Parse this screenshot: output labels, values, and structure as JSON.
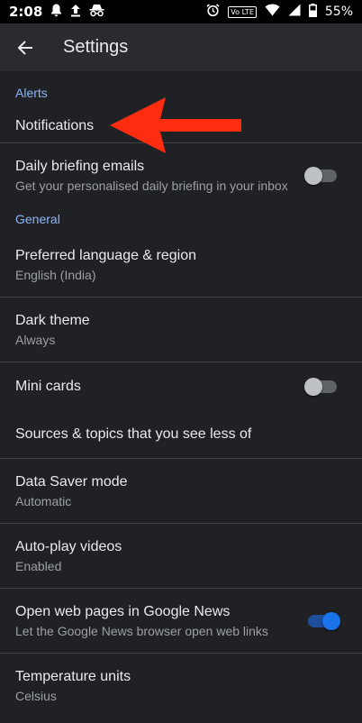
{
  "status_bar": {
    "time": "2:08",
    "network_badge": "Vo LTE",
    "battery": "55%",
    "left_icons": [
      "bell-icon",
      "upload-icon",
      "incognito-icon"
    ],
    "right_icons": [
      "alarm-icon",
      "wifi-icon",
      "signal-icon",
      "battery-icon"
    ]
  },
  "app_bar": {
    "title": "Settings",
    "back_icon": "arrow-back-icon"
  },
  "sections": {
    "alerts": {
      "header": "Alerts",
      "notifications": {
        "title": "Notifications"
      },
      "daily_briefing": {
        "title": "Daily briefing emails",
        "subtitle": "Get your personalised daily briefing in your inbox",
        "enabled": false
      }
    },
    "general": {
      "header": "General",
      "language": {
        "title": "Preferred language & region",
        "subtitle": "English (India)"
      },
      "dark_theme": {
        "title": "Dark theme",
        "subtitle": "Always"
      },
      "mini_cards": {
        "title": "Mini cards",
        "enabled": false
      },
      "sources": {
        "title": "Sources & topics that you see less of"
      },
      "data_saver": {
        "title": "Data Saver mode",
        "subtitle": "Automatic"
      },
      "autoplay": {
        "title": "Auto-play videos",
        "subtitle": "Enabled"
      },
      "open_web": {
        "title": "Open web pages in Google News",
        "subtitle": "Let the Google News browser open web links",
        "enabled": true
      },
      "temperature": {
        "title": "Temperature units",
        "subtitle": "Celsius"
      }
    }
  },
  "annotation": {
    "color": "#ff2d0f",
    "icon": "red-arrow-annotation"
  },
  "colors": {
    "background": "#202124",
    "accent": "#8ab4f8",
    "toggle_on": "#1a73e8"
  }
}
